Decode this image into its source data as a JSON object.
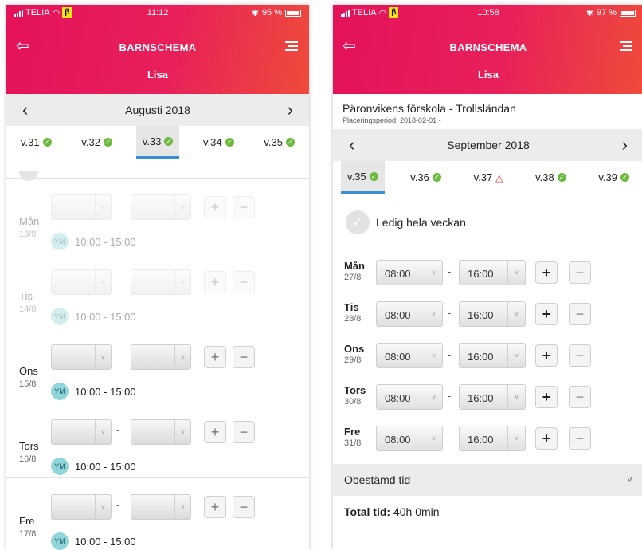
{
  "left": {
    "status": {
      "carrier": "TELIA",
      "beta": "β",
      "time": "11:12",
      "bluetooth": "✱",
      "battery": "95 %"
    },
    "header": {
      "title": "BARNSCHEMA",
      "child": "Lisa"
    },
    "month": "Augusti 2018",
    "weeks": [
      {
        "label": "v.31",
        "status": "ok"
      },
      {
        "label": "v.32",
        "status": "ok"
      },
      {
        "label": "v.33",
        "status": "ok",
        "active": true
      },
      {
        "label": "v.34",
        "status": "ok"
      },
      {
        "label": "v.35",
        "status": "ok"
      }
    ],
    "days": [
      {
        "name": "Mån",
        "date": "13/8",
        "avatar": "YM",
        "time": "10:00 - 15:00",
        "muted": true
      },
      {
        "name": "Tis",
        "date": "14/8",
        "avatar": "YM",
        "time": "10:00 - 15:00",
        "muted": true
      },
      {
        "name": "Ons",
        "date": "15/8",
        "avatar": "YM",
        "time": "10:00 - 15:00",
        "muted": false
      },
      {
        "name": "Tors",
        "date": "16/8",
        "avatar": "YM",
        "time": "10:00 - 15:00",
        "muted": false
      },
      {
        "name": "Fre",
        "date": "17/8",
        "avatar": "YM",
        "time": "10:00 - 15:00",
        "muted": false
      }
    ]
  },
  "right": {
    "status": {
      "carrier": "TELIA",
      "beta": "β",
      "time": "10:58",
      "bluetooth": "✱",
      "battery": "97 %"
    },
    "header": {
      "title": "BARNSCHEMA",
      "child": "Lisa"
    },
    "school": "Päronvikens förskola - Trollsländan",
    "placement": "Placeringsperiod: 2018-02-01 -",
    "month": "September 2018",
    "weeks": [
      {
        "label": "v.35",
        "status": "ok",
        "active": true
      },
      {
        "label": "v.36",
        "status": "ok"
      },
      {
        "label": "v.37",
        "status": "warn"
      },
      {
        "label": "v.38",
        "status": "ok"
      },
      {
        "label": "v.39",
        "status": "ok"
      }
    ],
    "ledig": "Ledig hela veckan",
    "days": [
      {
        "name": "Mån",
        "date": "27/8",
        "from": "08:00",
        "to": "16:00"
      },
      {
        "name": "Tis",
        "date": "28/8",
        "from": "08:00",
        "to": "16:00"
      },
      {
        "name": "Ons",
        "date": "29/8",
        "from": "08:00",
        "to": "16:00"
      },
      {
        "name": "Tors",
        "date": "30/8",
        "from": "08:00",
        "to": "16:00"
      },
      {
        "name": "Fre",
        "date": "31/8",
        "from": "08:00",
        "to": "16:00"
      }
    ],
    "obestamd": "Obestämd tid",
    "total_label": "Total tid:",
    "total_value": "40h 0min"
  },
  "symbols": {
    "dash": "-",
    "plus": "+",
    "minus": "−",
    "back": "⇦",
    "prev": "‹",
    "next": "›",
    "caret": "˅",
    "check": "✓",
    "warn": "△",
    "chevron_down": "˅"
  },
  "colors": {
    "header_start": "#e4125a",
    "header_end": "#ef4b3a",
    "ok": "#6dbb3e",
    "warn": "#e43e47",
    "active_tab": "#3b8fd6",
    "avatar": "#8fd5d9"
  }
}
